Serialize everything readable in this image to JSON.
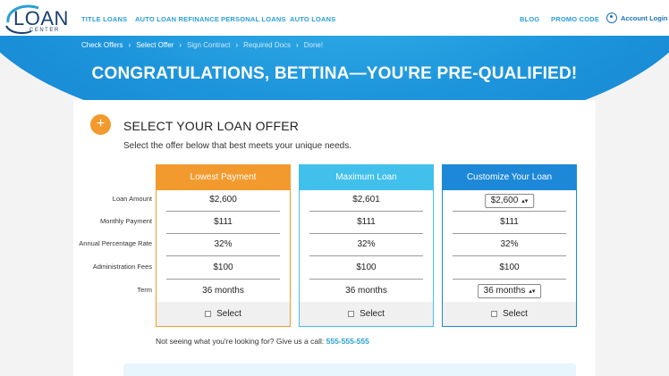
{
  "brand": {
    "logo_text": "LOAN",
    "logo_sub": "CENTER"
  },
  "nav": {
    "links": [
      "TITLE LOANS",
      "AUTO LOAN REFINANCE",
      "PERSONAL LOANS",
      "AUTO LOANS"
    ],
    "right_links": [
      "BLOG",
      "PROMO CODE"
    ],
    "account_label": "Account Login"
  },
  "steps": [
    "Check Offers",
    "Select Offer",
    "Sign Contract",
    "Required Docs",
    "Done!"
  ],
  "hero_title": "CONGRATULATIONS, BETTINA—YOU'RE PRE-QUALIFIED!",
  "card": {
    "plus": "+",
    "title": "SELECT YOUR LOAN OFFER",
    "subtitle": "Select the offer below that best meets your unique needs.",
    "row_labels": [
      "Loan Amount",
      "Monthly Payment",
      "Annual Percentage Rate",
      "Administration Fees",
      "Term"
    ],
    "offers": [
      {
        "name": "Lowest Payment",
        "color": "#f39a2e",
        "values": [
          "$2,600",
          "$111",
          "32%",
          "$100",
          "36 months"
        ],
        "select_label": "Select"
      },
      {
        "name": "Maximum Loan",
        "color": "#41c0ec",
        "values": [
          "$2,601",
          "$111",
          "32%",
          "$100",
          "36 months"
        ],
        "select_label": "Select"
      },
      {
        "name": "Customize Your Loan",
        "color": "#1e88d8",
        "values": [
          "$2,600",
          "$111",
          "32%",
          "$100",
          "36 months"
        ],
        "select_label": "Select"
      }
    ],
    "call_text": "Not seeing what you're looking for? Give us a call: ",
    "phone": "555-555-555"
  }
}
